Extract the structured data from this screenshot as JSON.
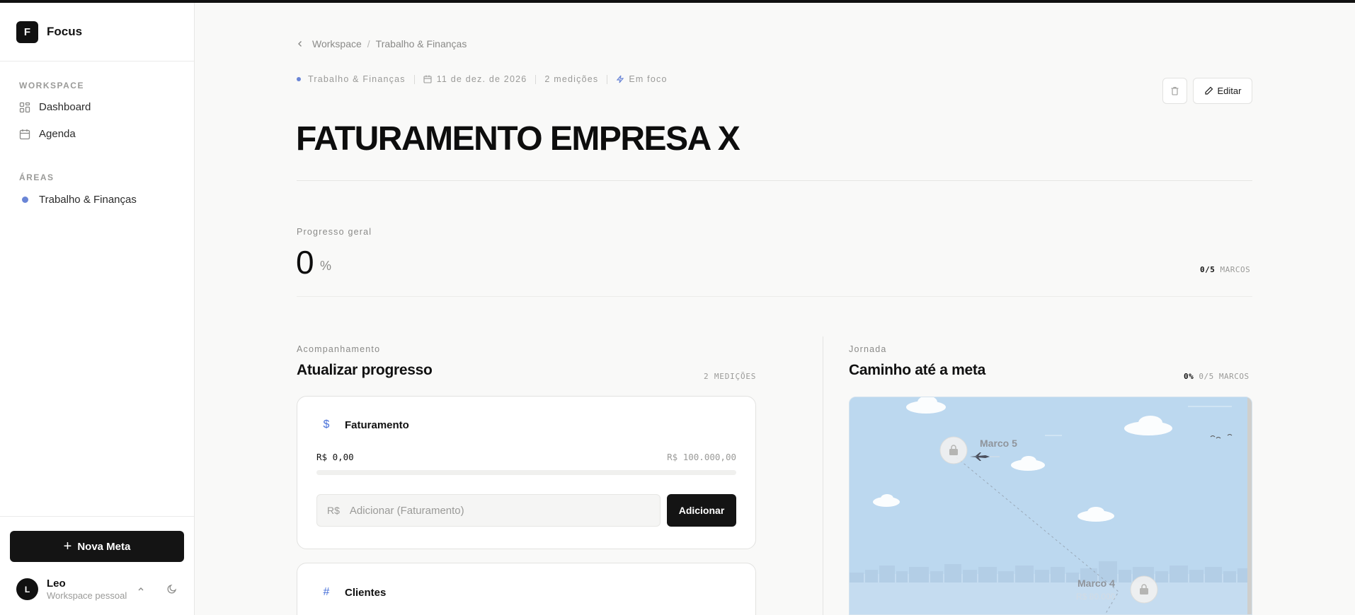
{
  "app": {
    "logo_letter": "F",
    "name": "Focus"
  },
  "sidebar": {
    "workspace_heading": "WORKSPACE",
    "items": [
      {
        "label": "Dashboard",
        "icon": "dashboard-grid-icon"
      },
      {
        "label": "Agenda",
        "icon": "calendar-icon"
      }
    ],
    "areas_heading": "ÁREAS",
    "areas": [
      {
        "label": "Trabalho & Finanças",
        "color": "#6a85d6"
      }
    ],
    "new_goal_label": "Nova Meta",
    "user": {
      "initial": "L",
      "name": "Leo",
      "subtitle": "Workspace pessoal"
    }
  },
  "breadcrumb": {
    "root": "Workspace",
    "current": "Trabalho & Finanças"
  },
  "meta": {
    "area": "Trabalho & Finanças",
    "date": "11 de dez. de 2026",
    "measurements": "2 medições",
    "status": "Em foco"
  },
  "actions": {
    "edit_label": "Editar"
  },
  "goal": {
    "title": "FATURAMENTO EMPRESA X"
  },
  "progress": {
    "label": "Progresso geral",
    "value": "0",
    "unit": "%",
    "milestones_done": "0/5",
    "milestones_label": "MARCOS"
  },
  "tracking": {
    "section_label": "Acompanhamento",
    "title": "Atualizar progresso",
    "count": "2 MEDIÇÕES",
    "cards": [
      {
        "icon": "dollar-icon",
        "icon_glyph": "$",
        "name": "Faturamento",
        "current": "R$ 0,00",
        "target": "R$ 100.000,00",
        "progress": 0,
        "input_prefix": "R$",
        "input_placeholder": "Adicionar (Faturamento)",
        "add_label": "Adicionar"
      },
      {
        "icon": "hash-icon",
        "icon_glyph": "#",
        "name": "Clientes"
      }
    ]
  },
  "journey": {
    "section_label": "Jornada",
    "title": "Caminho até a meta",
    "percent": "0%",
    "milestones_done": "0/5",
    "milestones_label": "MARCOS",
    "milestones": [
      {
        "label": "Marco 5"
      },
      {
        "label": "Marco 4",
        "value": "R$ 80.000"
      }
    ]
  },
  "colors": {
    "accent": "#4a72d9",
    "area_dot": "#6a85d6",
    "sky": "#bcd8ef",
    "dark": "#141414"
  }
}
